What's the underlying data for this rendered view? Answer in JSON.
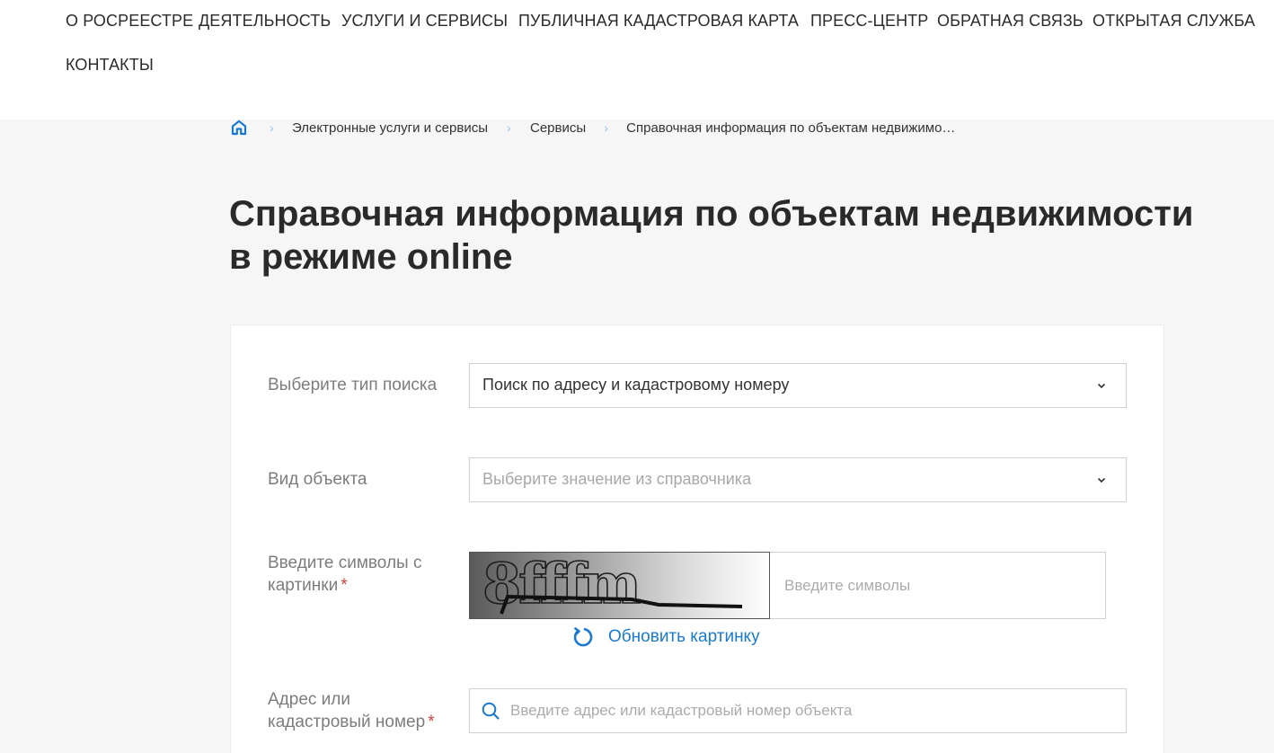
{
  "nav": {
    "items": [
      "О РОСРЕЕСТРЕ",
      "ДЕЯТЕЛЬНОСТЬ",
      "УСЛУГИ И СЕРВИСЫ",
      "ПУБЛИЧНАЯ КАДАСТРОВАЯ КАРТА",
      "ПРЕСС-ЦЕНТР",
      "ОБРАТНАЯ СВЯЗЬ",
      "ОТКРЫТАЯ СЛУЖБА",
      "КОНТАКТЫ"
    ]
  },
  "breadcrumb": {
    "home_icon": "home-icon",
    "items": [
      "Электронные услуги и сервисы",
      "Сервисы",
      "Справочная информация по объектам недвижимо…"
    ],
    "separator": "›"
  },
  "page": {
    "title_line1": "Справочная информация по объектам недвижимости",
    "title_line2": "в режиме online"
  },
  "form": {
    "search_type": {
      "label": "Выберите тип поиска",
      "value": "Поиск по адресу и кадастровому номеру"
    },
    "object_type": {
      "label": "Вид объекта",
      "placeholder": "Выберите значение из справочника"
    },
    "captcha": {
      "label_line1": "Введите символы с",
      "label_line2": "картинки",
      "required_mark": "*",
      "image_text": "8fffm",
      "placeholder": "Введите символы",
      "refresh_label": "Обновить картинку"
    },
    "address": {
      "label_line1": "Адрес или",
      "label_line2": "кадастровый номер",
      "required_mark": "*",
      "placeholder": "Введите адрес или кадастровый номер объекта"
    }
  },
  "colors": {
    "accent": "#1a7ad0",
    "required": "#d33f3f",
    "background": "#f6f6f6"
  }
}
